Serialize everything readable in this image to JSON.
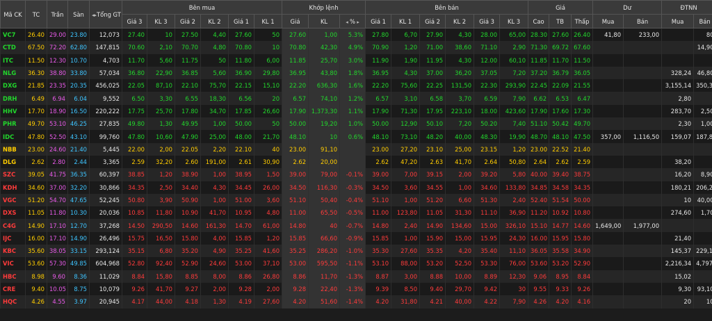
{
  "headers": {
    "symbol": "Mã CK",
    "ref": "TC",
    "ceil": "Trần",
    "floor": "Sàn",
    "total": "Tổng GT",
    "buy_group": "Bên mua",
    "match_group": "Khớp lệnh",
    "sell_group": "Bên bán",
    "price_group": "Giá",
    "residual_group": "Dư",
    "foreign_group": "ĐTNN",
    "sub": [
      "Giá 3",
      "KL 3",
      "Giá 2",
      "KL 2",
      "Giá 1",
      "KL 1",
      "Giá",
      "KL",
      "%",
      "Giá 1",
      "KL 1",
      "Giá 2",
      "KL 2",
      "Giá 3",
      "KL 3",
      "Cao",
      "TB",
      "Thấp",
      "Mua",
      "Bán",
      "Mua",
      "Bán"
    ]
  },
  "colors": {
    "up": "#22d62c",
    "down": "#ff3b3b",
    "ref": "#ffcc00",
    "ceil": "#e85ae8",
    "floor": "#3ec4ff"
  },
  "rows": [
    {
      "c": "u",
      "v": [
        "VC7",
        "26.40",
        "29.00",
        "23.80",
        "12,073",
        "27.40",
        "10",
        "27.50",
        "4,40",
        "27.60",
        "50",
        "27.60",
        "1,00",
        "5.3%",
        "27.80",
        "6,70",
        "27.90",
        "4,30",
        "28.00",
        "65,00",
        "28.30",
        "27.60",
        "26.40",
        "41,80",
        "233,00",
        "",
        "80"
      ]
    },
    {
      "c": "u",
      "v": [
        "CTD",
        "67.50",
        "72.20",
        "62.80",
        "147,815",
        "70.60",
        "2,10",
        "70.70",
        "4,80",
        "70.80",
        "10",
        "70.80",
        "42,30",
        "4.9%",
        "70.90",
        "1,20",
        "71.00",
        "38,60",
        "71.10",
        "2,90",
        "71.30",
        "69.72",
        "67.60",
        "",
        "",
        "",
        "14,90"
      ]
    },
    {
      "c": "u",
      "v": [
        "ITC",
        "11.50",
        "12.30",
        "10.70",
        "4,703",
        "11.70",
        "5,60",
        "11.75",
        "50",
        "11.80",
        "6,00",
        "11.85",
        "25,70",
        "3.0%",
        "11.90",
        "1,90",
        "11.95",
        "4,30",
        "12.00",
        "60,10",
        "11.85",
        "11.70",
        "11.50",
        "",
        "",
        "",
        ""
      ]
    },
    {
      "c": "u",
      "v": [
        "NLG",
        "36.30",
        "38.80",
        "33.80",
        "57,034",
        "36.80",
        "22,90",
        "36.85",
        "5,60",
        "36.90",
        "29,80",
        "36.95",
        "43,80",
        "1.8%",
        "36.95",
        "4,30",
        "37.00",
        "36,20",
        "37.05",
        "7,20",
        "37.20",
        "36.79",
        "36.05",
        "",
        "",
        "328,24",
        "46,80"
      ]
    },
    {
      "c": "u",
      "v": [
        "DXG",
        "21.85",
        "23.35",
        "20.35",
        "456,025",
        "22.05",
        "87,10",
        "22.10",
        "75,70",
        "22.15",
        "15,10",
        "22.20",
        "636,30",
        "1.6%",
        "22.20",
        "75,60",
        "22.25",
        "131,50",
        "22.30",
        "293,90",
        "22.45",
        "22.09",
        "21.55",
        "",
        "",
        "3,155,14",
        "350,30"
      ]
    },
    {
      "c": "u",
      "v": [
        "DRH",
        "6.49",
        "6.94",
        "6.04",
        "9,552",
        "6.50",
        "3,30",
        "6.55",
        "18,30",
        "6.56",
        "20",
        "6.57",
        "74,10",
        "1.2%",
        "6.57",
        "3,10",
        "6.58",
        "3,70",
        "6.59",
        "7,90",
        "6.62",
        "6.53",
        "6.47",
        "",
        "",
        "2,80",
        ""
      ]
    },
    {
      "c": "u",
      "v": [
        "HHV",
        "17.70",
        "18.90",
        "16.50",
        "220,222",
        "17.75",
        "25,70",
        "17.80",
        "34,70",
        "17.85",
        "26,60",
        "17.90",
        "1,373,30",
        "1.1%",
        "17.90",
        "71,30",
        "17.95",
        "223,10",
        "18.00",
        "423,60",
        "17.90",
        "17.60",
        "17.30",
        "",
        "",
        "283,70",
        "2,50"
      ]
    },
    {
      "c": "u",
      "v": [
        "PHR",
        "49.70",
        "53.10",
        "46.25",
        "27,835",
        "49.80",
        "1,30",
        "49.95",
        "1,00",
        "50.00",
        "50",
        "50.00",
        "19,20",
        "1.0%",
        "50.00",
        "12,90",
        "50.10",
        "7,20",
        "50.20",
        "7,40",
        "51.10",
        "50.42",
        "49.70",
        "",
        "",
        "2,30",
        "1,00"
      ]
    },
    {
      "c": "u",
      "v": [
        "IDC",
        "47.80",
        "52.50",
        "43.10",
        "99,760",
        "47.80",
        "10,60",
        "47.90",
        "25,00",
        "48.00",
        "21,70",
        "48.10",
        "10",
        "0.6%",
        "48.10",
        "73,10",
        "48.20",
        "40,00",
        "48.30",
        "19,90",
        "48.70",
        "48.10",
        "47.50",
        "357,00",
        "1,116,50",
        "159,07",
        "187,85"
      ]
    },
    {
      "c": "r",
      "v": [
        "NBB",
        "23.00",
        "24.60",
        "21.40",
        "5,445",
        "22.00",
        "2,00",
        "22.05",
        "2,20",
        "22.10",
        "40",
        "23.00",
        "91,10",
        "",
        "23.00",
        "27,20",
        "23.10",
        "25,00",
        "23.15",
        "1,20",
        "23.00",
        "22.52",
        "21.40",
        "",
        "",
        "",
        ""
      ]
    },
    {
      "c": "r",
      "v": [
        "DLG",
        "2.62",
        "2.80",
        "2.44",
        "3,365",
        "2.59",
        "32,20",
        "2.60",
        "191,00",
        "2.61",
        "30,90",
        "2.62",
        "20,00",
        "",
        "2.62",
        "47,20",
        "2.63",
        "41,70",
        "2.64",
        "50,80",
        "2.64",
        "2.62",
        "2.59",
        "",
        "",
        "38,20",
        ""
      ]
    },
    {
      "c": "d",
      "v": [
        "SZC",
        "39.05",
        "41.75",
        "36.35",
        "60,397",
        "38.85",
        "1,20",
        "38.90",
        "1,00",
        "38.95",
        "1,50",
        "39.00",
        "79,00",
        "-0.1%",
        "39.00",
        "7,00",
        "39.15",
        "2,00",
        "39.20",
        "5,80",
        "40.00",
        "39.40",
        "38.75",
        "",
        "",
        "16,20",
        "8,90"
      ]
    },
    {
      "c": "d",
      "v": [
        "KDH",
        "34.60",
        "37.00",
        "32.20",
        "30,866",
        "34.35",
        "2,50",
        "34.40",
        "4,30",
        "34.45",
        "26,00",
        "34.50",
        "116,30",
        "-0.3%",
        "34.50",
        "3,60",
        "34.55",
        "1,00",
        "34.60",
        "133,80",
        "34.85",
        "34.58",
        "34.35",
        "",
        "",
        "180,21",
        "206,20"
      ]
    },
    {
      "c": "d",
      "v": [
        "VGC",
        "51.20",
        "54.70",
        "47.65",
        "52,245",
        "50.80",
        "3,90",
        "50.90",
        "1,00",
        "51.00",
        "3,60",
        "51.10",
        "50,40",
        "-0.4%",
        "51.10",
        "1,00",
        "51.20",
        "6,60",
        "51.30",
        "2,40",
        "52.40",
        "51.54",
        "50.00",
        "",
        "",
        "10",
        "40,00"
      ]
    },
    {
      "c": "d",
      "v": [
        "DXS",
        "11.05",
        "11.80",
        "10.30",
        "20,036",
        "10.85",
        "11,80",
        "10.90",
        "41,70",
        "10.95",
        "4,80",
        "11.00",
        "65,50",
        "-0.5%",
        "11.00",
        "123,80",
        "11.05",
        "31,30",
        "11.10",
        "36,90",
        "11.20",
        "10.92",
        "10.80",
        "",
        "",
        "274,60",
        "1,70"
      ]
    },
    {
      "c": "d",
      "v": [
        "C4G",
        "14.90",
        "17.10",
        "12.70",
        "37,268",
        "14.50",
        "290,50",
        "14.60",
        "161,30",
        "14.70",
        "61,00",
        "14.80",
        "40",
        "-0.7%",
        "14.80",
        "2,40",
        "14.90",
        "134,60",
        "15.00",
        "326,10",
        "15.10",
        "14.77",
        "14.60",
        "1,649,00",
        "1,977,00",
        "",
        ""
      ]
    },
    {
      "c": "d",
      "v": [
        "IJC",
        "16.00",
        "17.10",
        "14.90",
        "26,496",
        "15.75",
        "16,50",
        "15.80",
        "4,00",
        "15.85",
        "1,20",
        "15.85",
        "66,60",
        "-0.9%",
        "15.85",
        "1,00",
        "15.90",
        "15,00",
        "15.95",
        "24,30",
        "16.00",
        "15.95",
        "15.80",
        "",
        "",
        "21,40",
        ""
      ]
    },
    {
      "c": "d",
      "v": [
        "KBC",
        "35.60",
        "38.05",
        "33.15",
        "293,124",
        "35.15",
        "6,80",
        "35.20",
        "4,90",
        "35.25",
        "41,60",
        "35.25",
        "286,20",
        "-1.0%",
        "35.30",
        "27,60",
        "35.35",
        "4,20",
        "35.40",
        "11,10",
        "36.05",
        "35.58",
        "34.90",
        "",
        "",
        "145,37",
        "229,10"
      ]
    },
    {
      "c": "d",
      "v": [
        "VIC",
        "53.60",
        "57.30",
        "49.85",
        "604,968",
        "52.80",
        "92,40",
        "52.90",
        "24,60",
        "53.00",
        "37,10",
        "53.00",
        "595,50",
        "-1.1%",
        "53.10",
        "88,00",
        "53.20",
        "52,50",
        "53.30",
        "76,00",
        "53.60",
        "53.20",
        "52.90",
        "",
        "",
        "2,216,34",
        "4,797,82"
      ]
    },
    {
      "c": "d",
      "v": [
        "HBC",
        "8.98",
        "9.60",
        "8.36",
        "11,029",
        "8.84",
        "15,80",
        "8.85",
        "8,00",
        "8.86",
        "26,80",
        "8.86",
        "11,70",
        "-1.3%",
        "8.87",
        "3,00",
        "8.88",
        "10,00",
        "8.89",
        "12,30",
        "9.06",
        "8.95",
        "8.84",
        "",
        "",
        "15,02",
        ""
      ]
    },
    {
      "c": "d",
      "v": [
        "CRE",
        "9.40",
        "10.05",
        "8.75",
        "10,079",
        "9.26",
        "41,70",
        "9.27",
        "2,00",
        "9.28",
        "2,00",
        "9.28",
        "22,40",
        "-1.3%",
        "9.39",
        "8,50",
        "9.40",
        "29,70",
        "9.42",
        "30",
        "9.55",
        "9.33",
        "9.26",
        "",
        "",
        "9,30",
        "93,10"
      ]
    },
    {
      "c": "d",
      "v": [
        "HQC",
        "4.26",
        "4.55",
        "3.97",
        "20,945",
        "4.17",
        "44,00",
        "4.18",
        "1,30",
        "4.19",
        "27,60",
        "4.20",
        "51,60",
        "-1.4%",
        "4.20",
        "31,80",
        "4.21",
        "40,00",
        "4.22",
        "7,90",
        "4.26",
        "4.20",
        "4.16",
        "",
        "",
        "20",
        "10"
      ]
    }
  ]
}
